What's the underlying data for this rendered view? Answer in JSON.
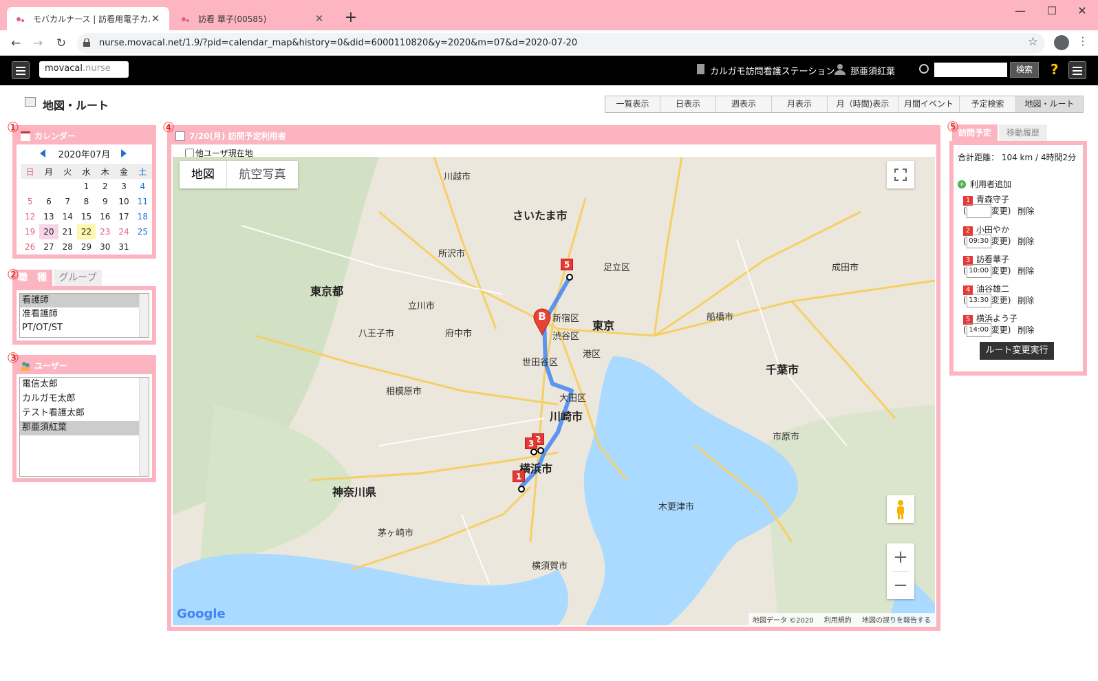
{
  "browser": {
    "tabs": [
      {
        "title": "モバカルナース | 訪看用電子カルテ",
        "active": true
      },
      {
        "title": "訪看 華子(00585)",
        "active": false
      }
    ],
    "url": "nurse.movacal.net/1.9/?pid=calendar_map&history=0&did=6000110820&y=2020&m=07&d=2020-07-20"
  },
  "header": {
    "logo_a": "movacal",
    "logo_b": ".nurse",
    "station": "カルガモ訪問看護ステーション",
    "user": "那亜須紅葉",
    "search_button": "検索",
    "help": "?"
  },
  "page": {
    "title": "地図・ルート",
    "view_tabs": [
      "一覧表示",
      "日表示",
      "週表示",
      "月表示",
      "月（時間)表示",
      "月間イベント",
      "予定検索",
      "地図・ルート"
    ]
  },
  "annotations": [
    "①",
    "②",
    "③",
    "④",
    "⑤"
  ],
  "calendar": {
    "header": "カレンダー",
    "month": "2020年07月",
    "weekdays": [
      "日",
      "月",
      "火",
      "水",
      "木",
      "金",
      "土"
    ],
    "weeks": [
      [
        "",
        "",
        "",
        "1",
        "2",
        "3",
        "4"
      ],
      [
        "5",
        "6",
        "7",
        "8",
        "9",
        "10",
        "11"
      ],
      [
        "12",
        "13",
        "14",
        "15",
        "16",
        "17",
        "18"
      ],
      [
        "19",
        "20",
        "21",
        "22",
        "23",
        "24",
        "25"
      ],
      [
        "26",
        "27",
        "28",
        "29",
        "30",
        "31",
        ""
      ]
    ]
  },
  "jobtype": {
    "tabs": [
      "職　種",
      "グループ"
    ],
    "items": [
      "看護師",
      "准看護師",
      "PT/OT/ST"
    ]
  },
  "users": {
    "header": "ユーザー",
    "items": [
      "電信太郎",
      "カルガモ太郎",
      "テスト看護太郎",
      "那亜須紅葉"
    ]
  },
  "map_panel": {
    "header": "7/20(月) 訪問予定利用者",
    "checkbox_label": "他ユーザ現在地",
    "type_buttons": [
      "地図",
      "航空写真"
    ],
    "labels": {
      "tokyo": "東京",
      "saitama": "さいたま市",
      "kawasaki": "川崎市",
      "yokohama": "横浜市",
      "chiba": "千葉市",
      "tokyoto": "東京都",
      "kanagawa": "神奈川県",
      "shinjuku": "新宿区",
      "shibuya": "渋谷区",
      "setagaya": "世田谷区",
      "ota": "大田区",
      "minato": "港区",
      "hachioji": "八王子市",
      "sagamihara": "相模原市",
      "funabashi": "船橋市",
      "yokosuka": "横須賀市",
      "kisarazu": "木更津市",
      "kawagoe": "川越市",
      "tokorozawa": "所沢市",
      "tachikawa": "立川市",
      "fuchu": "府中市",
      "adachi": "足立区",
      "ichikawa": "市原市",
      "kamakura": "茅ヶ崎市",
      "narita": "成田市"
    },
    "markers": [
      "1",
      "2",
      "3",
      "5"
    ],
    "b_marker": "B",
    "footer": [
      "地図データ ©2020",
      "利用規約",
      "地図の誤りを報告する"
    ],
    "google": "Google",
    "zoom_in": "+",
    "zoom_out": "−"
  },
  "schedule": {
    "tabs": [
      "訪問予定",
      "移動履歴"
    ],
    "total": "合計距離： 104 km / 4時間2分",
    "add_user": "利用者追加",
    "change_label": "変更)",
    "delete_label": "削除",
    "items": [
      {
        "num": "1",
        "name": "青森守子",
        "time": ""
      },
      {
        "num": "2",
        "name": "小田やか",
        "time": "09:30"
      },
      {
        "num": "3",
        "name": "訪看華子",
        "time": "10:00"
      },
      {
        "num": "4",
        "name": "油谷雄二",
        "time": "13:30"
      },
      {
        "num": "5",
        "name": "横浜よう子",
        "time": "14:00"
      }
    ],
    "route_button": "ルート変更実行"
  }
}
